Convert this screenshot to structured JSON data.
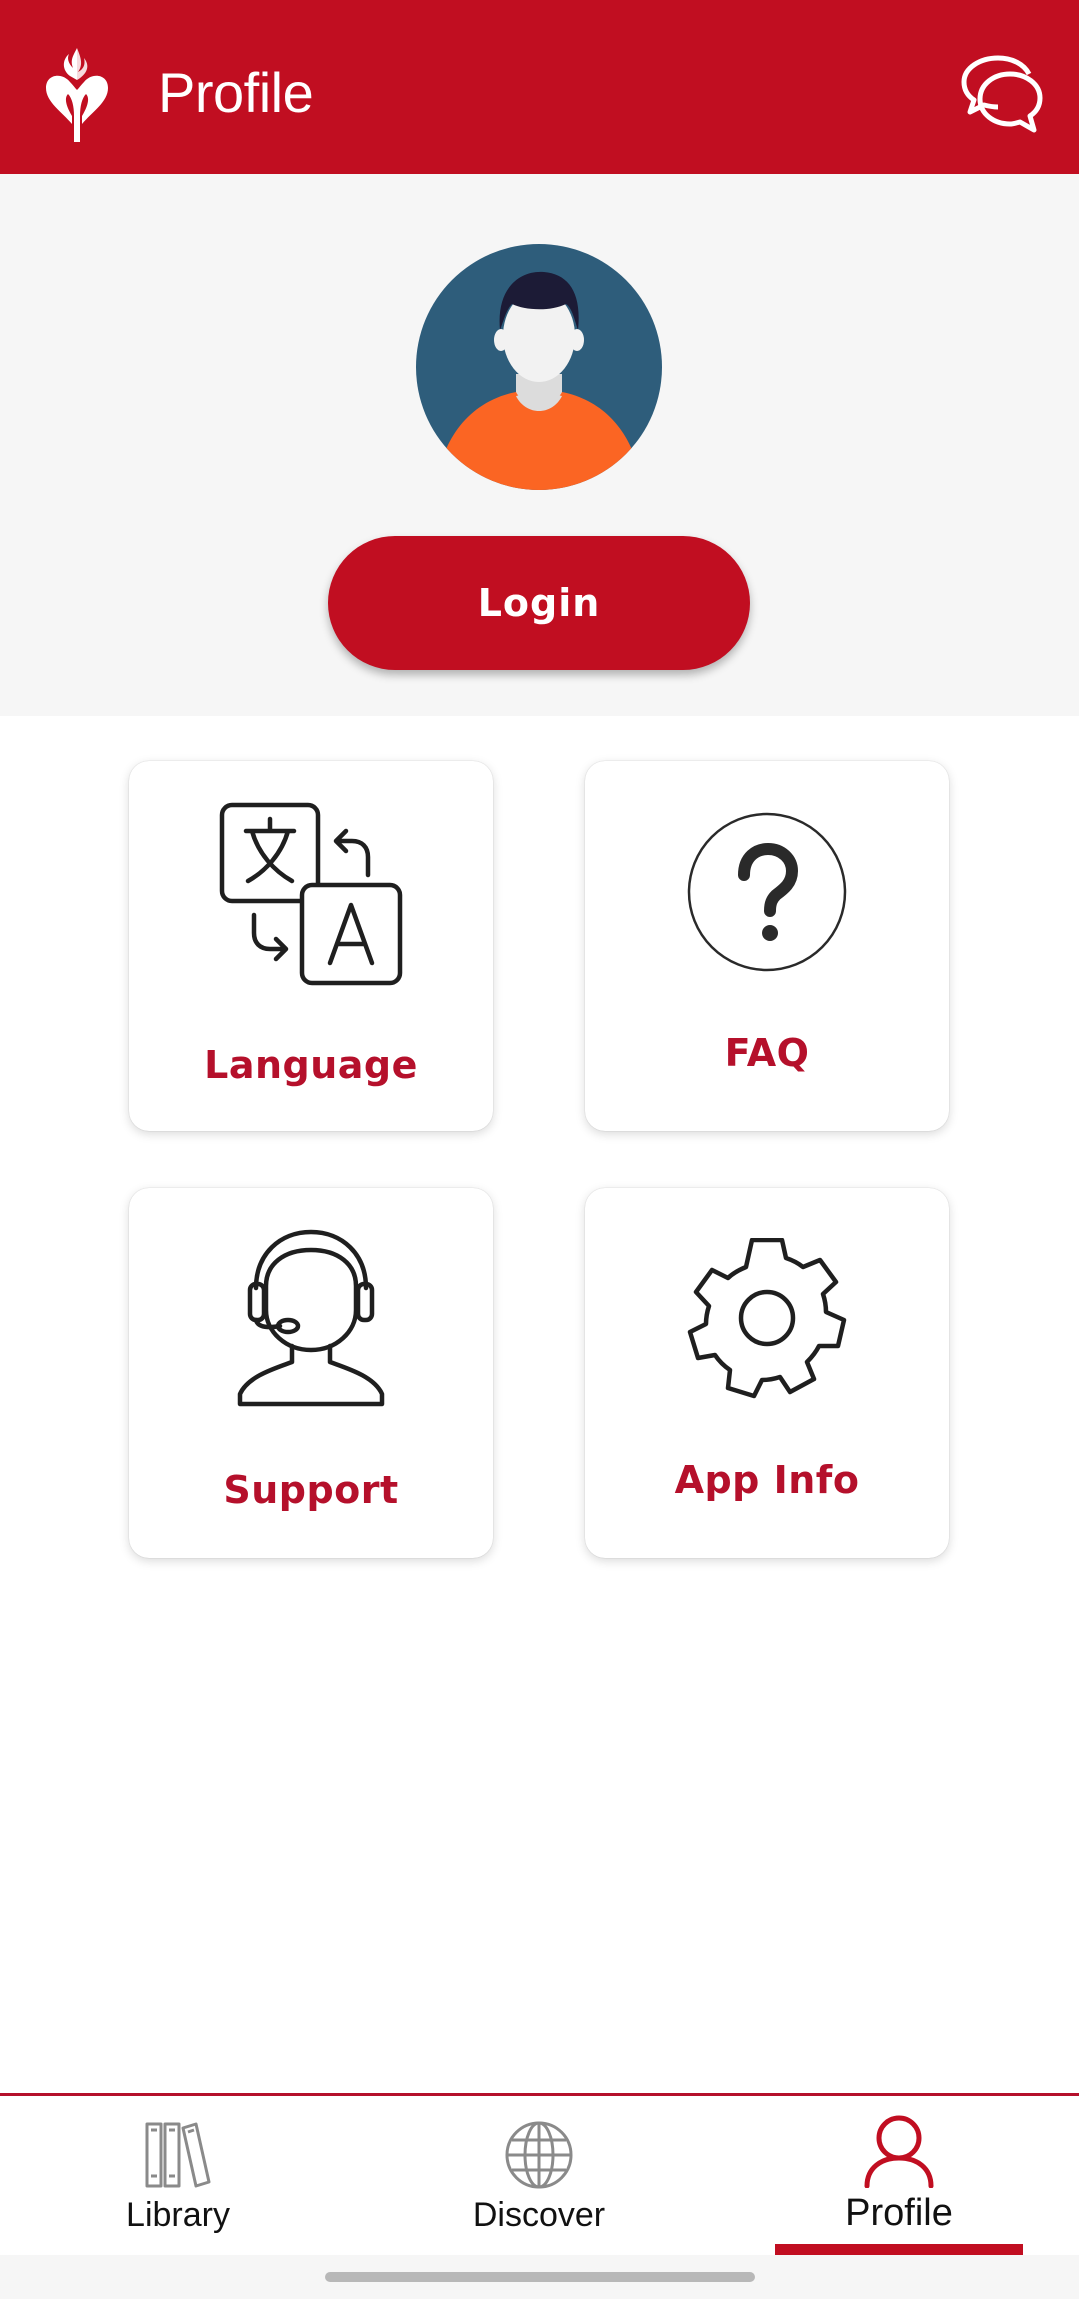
{
  "header": {
    "title": "Profile",
    "logo_icon": "heart-torch-logo",
    "chat_icon": "chat-bubbles-icon",
    "background_color": "#c10e21"
  },
  "profile": {
    "avatar_icon": "default-avatar",
    "login_label": "Login",
    "accent_color": "#c10e21"
  },
  "tiles": [
    {
      "label": "Language",
      "icon": "translate-icon"
    },
    {
      "label": "FAQ",
      "icon": "question-circle-icon"
    },
    {
      "label": "Support",
      "icon": "headset-agent-icon"
    },
    {
      "label": "App Info",
      "icon": "gear-icon"
    }
  ],
  "tabbar": {
    "items": [
      {
        "label": "Library",
        "icon": "books-icon"
      },
      {
        "label": "Discover",
        "icon": "globe-icon"
      },
      {
        "label": "Profile",
        "icon": "person-icon",
        "active": true
      }
    ],
    "active_color": "#c10e21"
  }
}
